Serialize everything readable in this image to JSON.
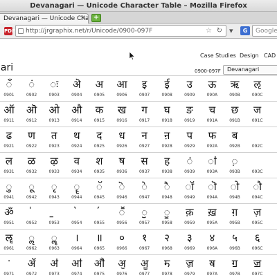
{
  "window": {
    "title": "Devanagari — Unicode Character Table – Mozilla Firefox"
  },
  "tab": {
    "label": "Devanagari — Unicode Character ...",
    "close": "✕",
    "new_tab": "+"
  },
  "navbar": {
    "pdf_icon": "pdf-icon",
    "url": "http://jrgraphix.net/r/Unicode/0900-097F",
    "star": "☆",
    "reload": "↻",
    "bookmark": "▾",
    "search_engine_label": "G",
    "search_placeholder": "Google"
  },
  "page": {
    "nav": [
      "Case Studies",
      "Design",
      "CAD"
    ],
    "title": "gari",
    "range_label": "0900-097F",
    "block_select": "Devanagari"
  },
  "rows": [
    {
      "glyphs": [
        "ँ",
        "ं",
        "ः",
        "ऄ",
        "अ",
        "आ",
        "इ",
        "ई",
        "उ",
        "ऊ",
        "ऋ",
        "ऌ"
      ],
      "codes": [
        "0901",
        "0902",
        "0903",
        "0904",
        "0905",
        "0906",
        "0907",
        "0908",
        "0909",
        "090A",
        "090B",
        "090C"
      ]
    },
    {
      "glyphs": [
        "ऑ",
        "ऒ",
        "ओ",
        "औ",
        "क",
        "ख",
        "ग",
        "घ",
        "ङ",
        "च",
        "छ",
        "ज"
      ],
      "codes": [
        "0911",
        "0912",
        "0913",
        "0914",
        "0915",
        "0916",
        "0917",
        "0918",
        "0919",
        "091A",
        "091B",
        "091C"
      ]
    },
    {
      "glyphs": [
        "ढ",
        "ण",
        "त",
        "थ",
        "द",
        "ध",
        "न",
        "ऩ",
        "प",
        "फ",
        "ब"
      ],
      "codes": [
        "0921",
        "0922",
        "0923",
        "0924",
        "0925",
        "0926",
        "0927",
        "0928",
        "0929",
        "092A",
        "092B",
        "092C"
      ]
    },
    {
      "glyphs": [
        "ल",
        "ळ",
        "ऴ",
        "व",
        "श",
        "ष",
        "स",
        "ह",
        "ऺ",
        "ऻ",
        "़"
      ],
      "codes": [
        "0931",
        "0932",
        "0933",
        "0934",
        "0935",
        "0936",
        "0937",
        "0938",
        "0939",
        "093A",
        "093B",
        "093C"
      ]
    },
    {
      "glyphs": [
        "ु",
        "ू",
        "ृ",
        "ॄ",
        "ॅ",
        "ॆ",
        "े",
        "ै",
        "ॉ",
        "ॊ",
        "ो",
        "ौ"
      ],
      "codes": [
        "0941",
        "0942",
        "0943",
        "0944",
        "0945",
        "0946",
        "0947",
        "0948",
        "0949",
        "094A",
        "094B",
        "094C"
      ]
    },
    {
      "glyphs": [
        "ॐ",
        "॑",
        "॒",
        "॓",
        "॔",
        "ॕ",
        "ॖ",
        "ॗ",
        "क़",
        "ख़",
        "ग़",
        "ज़"
      ],
      "codes": [
        "0951",
        "0952",
        "0953",
        "0954",
        "0955",
        "0956",
        "0957",
        "0958",
        "0959",
        "095A",
        "095B",
        "095C"
      ]
    },
    {
      "glyphs": [
        "ॡ",
        "ॢ",
        "ॣ",
        "।",
        "॥",
        "०",
        "१",
        "२",
        "३",
        "४",
        "५",
        "६"
      ],
      "codes": [
        "0961",
        "0962",
        "0963",
        "0964",
        "0965",
        "0966",
        "0967",
        "0968",
        "0969",
        "096A",
        "096B",
        "096C"
      ]
    },
    {
      "glyphs": [
        "ॱ",
        "ॲ",
        "ॳ",
        "ॴ",
        "ॵ",
        "ॶ",
        "ॷ",
        "ॸ",
        "ॹ",
        "ॺ",
        "ॻ",
        "ॼ"
      ],
      "codes": [
        "0971",
        "0972",
        "0973",
        "0974",
        "0975",
        "0976",
        "0977",
        "0978",
        "0979",
        "097A",
        "097B",
        "097C"
      ]
    }
  ]
}
